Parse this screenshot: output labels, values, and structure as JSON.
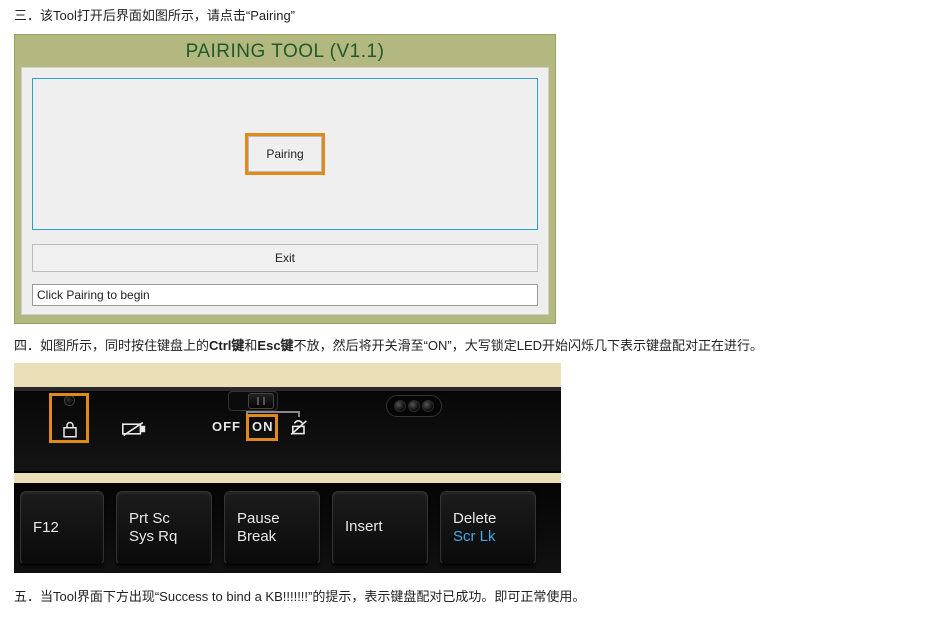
{
  "step3_prefix": "三．该Tool打开后界面如图所示，请点击",
  "step3_quote_open": "“",
  "step3_quote_word": "Pairing",
  "step3_quote_close": "”",
  "tool": {
    "title": "PAIRING TOOL (V1.1)",
    "pairing_label": "Pairing",
    "exit_label": "Exit",
    "status_text": "Click Pairing to begin"
  },
  "step4_a": "四．如图所示，同时按住键盘上的",
  "step4_b": "Ctrl键",
  "step4_c": "和",
  "step4_d": "Esc键",
  "step4_e": "不放，然后将开关滑至“ON”，大写锁定LED开始闪烁几下表示键盘配对正在进行。",
  "keyboard": {
    "off_label": "OFF",
    "on_label": "ON",
    "keys": {
      "f12": "F12",
      "prtsc_l1": "Prt Sc",
      "prtsc_l2": "Sys Rq",
      "pause_l1": "Pause",
      "pause_l2": "Break",
      "insert_l1": "Insert",
      "insert_l2": "",
      "delete_l1": "Delete",
      "delete_l2": "Scr Lk"
    }
  },
  "step5": "五．当Tool界面下方出现“Success to bind a KB!!!!!!!”的提示，表示键盘配对已成功。即可正常使用。"
}
